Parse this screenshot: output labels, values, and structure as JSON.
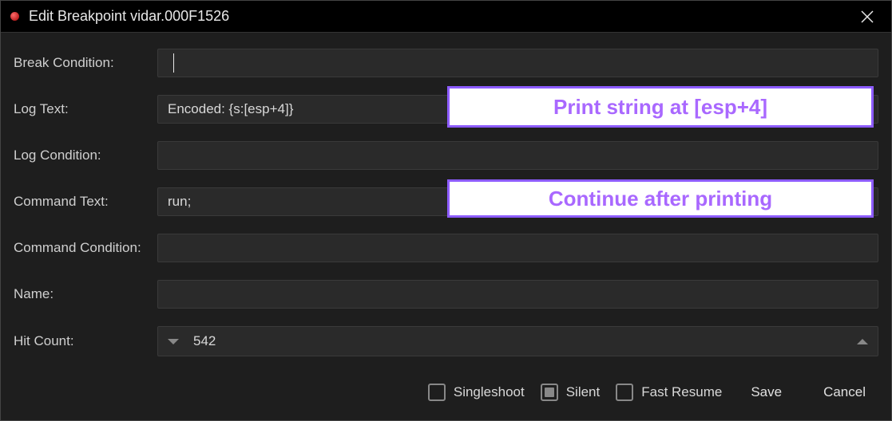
{
  "title": "Edit Breakpoint vidar.000F1526",
  "labels": {
    "break_condition": "Break Condition:",
    "log_text": "Log Text:",
    "log_condition": "Log Condition:",
    "command_text": "Command Text:",
    "command_condition": "Command Condition:",
    "name": "Name:",
    "hit_count": "Hit Count:"
  },
  "fields": {
    "break_condition": "",
    "log_text": "Encoded: {s:[esp+4]}",
    "log_condition": "",
    "command_text": "run;",
    "command_condition": "",
    "name": ""
  },
  "hit_count": "542",
  "checkboxes": {
    "singleshoot": {
      "label": "Singleshoot",
      "state": "unchecked"
    },
    "silent": {
      "label": "Silent",
      "state": "indeterminate"
    },
    "fast_resume": {
      "label": "Fast Resume",
      "state": "unchecked"
    }
  },
  "buttons": {
    "save": "Save",
    "cancel": "Cancel"
  },
  "annotations": {
    "print_string": "Print string at [esp+4]",
    "continue_after": "Continue after printing"
  }
}
